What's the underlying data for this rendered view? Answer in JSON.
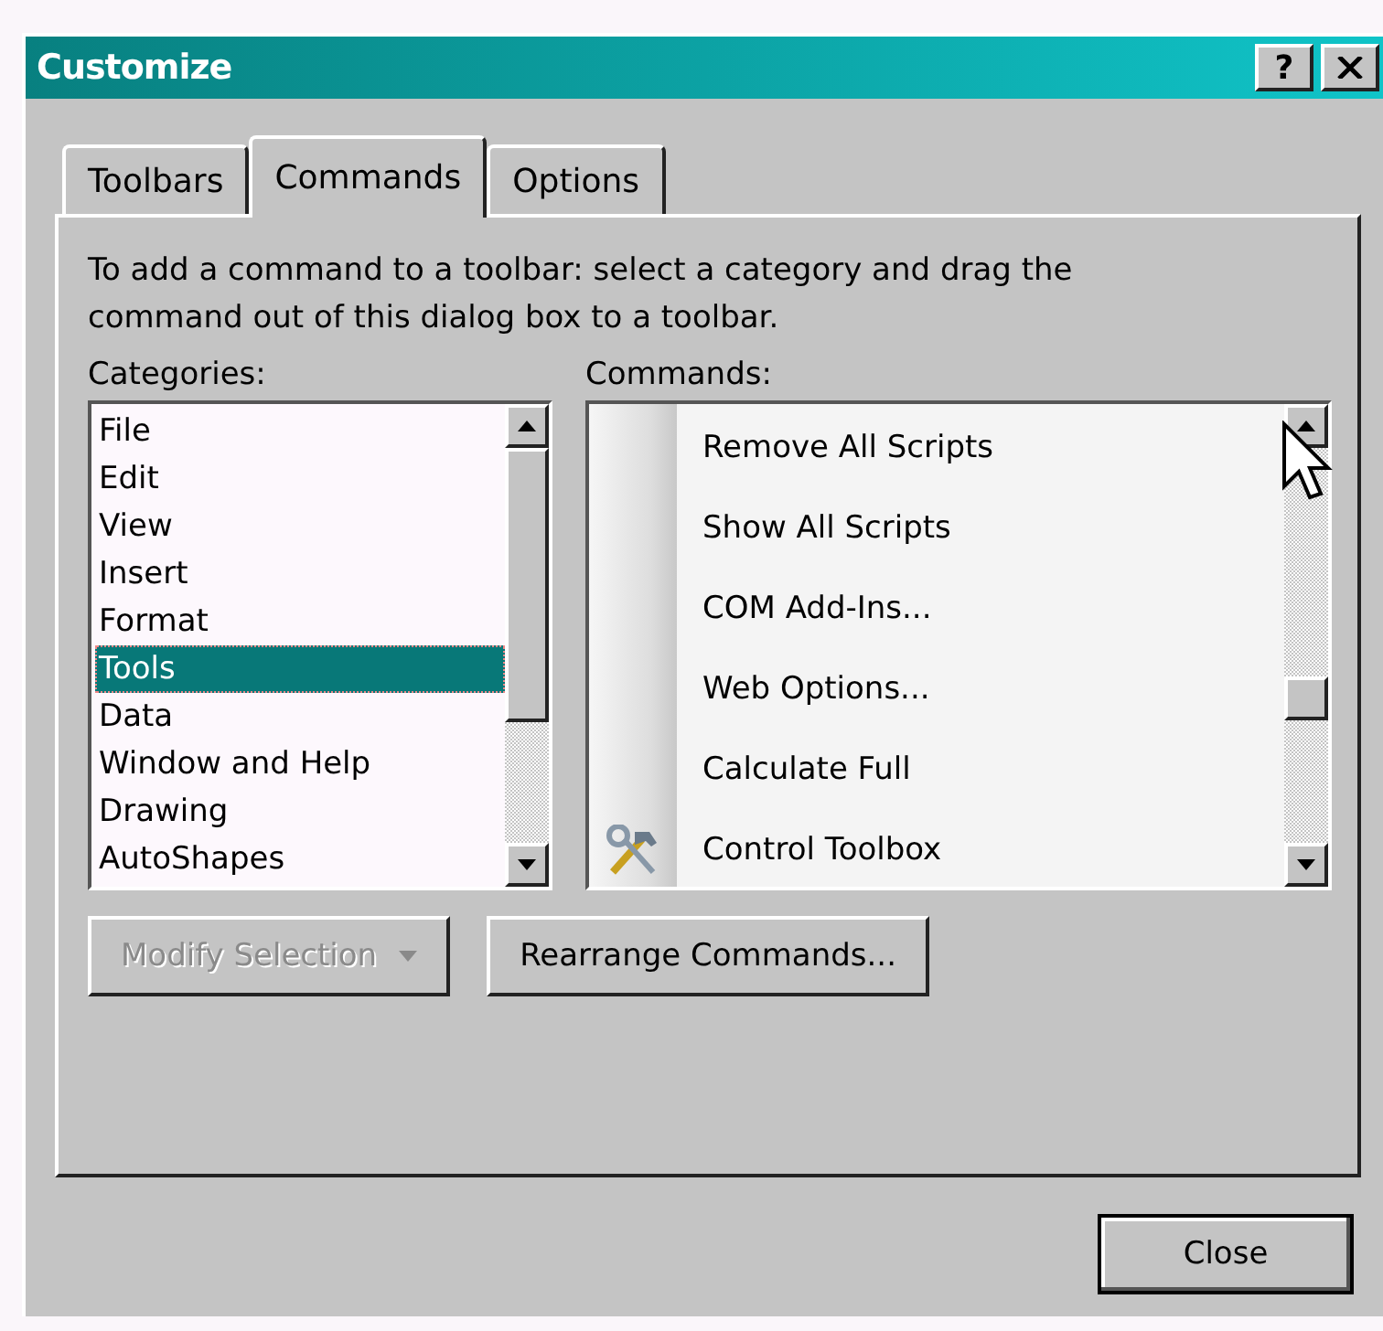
{
  "window": {
    "title": "Customize",
    "help_button": "?"
  },
  "tabs": [
    {
      "label": "Toolbars",
      "selected": false
    },
    {
      "label": "Commands",
      "selected": true
    },
    {
      "label": "Options",
      "selected": false
    }
  ],
  "instructions": "To add a command to a toolbar: select a category and drag the command out of this dialog box to a toolbar.",
  "categories": {
    "label": "Categories:",
    "items": [
      {
        "label": "File",
        "selected": false
      },
      {
        "label": "Edit",
        "selected": false
      },
      {
        "label": "View",
        "selected": false
      },
      {
        "label": "Insert",
        "selected": false
      },
      {
        "label": "Format",
        "selected": false
      },
      {
        "label": "Tools",
        "selected": true
      },
      {
        "label": "Data",
        "selected": false
      },
      {
        "label": "Window and Help",
        "selected": false
      },
      {
        "label": "Drawing",
        "selected": false
      },
      {
        "label": "AutoShapes",
        "selected": false
      }
    ]
  },
  "commands": {
    "label": "Commands:",
    "items": [
      {
        "label": "Remove All Scripts",
        "icon": false
      },
      {
        "label": "Show All Scripts",
        "icon": false
      },
      {
        "label": "COM Add-Ins...",
        "icon": false
      },
      {
        "label": "Web Options...",
        "icon": false
      },
      {
        "label": "Calculate Full",
        "icon": false
      },
      {
        "label": "Control Toolbox",
        "icon": true
      }
    ]
  },
  "buttons": [
    {
      "label": "Modify Selection",
      "disabled": true,
      "dropdown": true
    },
    {
      "label": "Rearrange Commands...",
      "disabled": false,
      "dropdown": false
    }
  ],
  "close_button": "Close"
}
